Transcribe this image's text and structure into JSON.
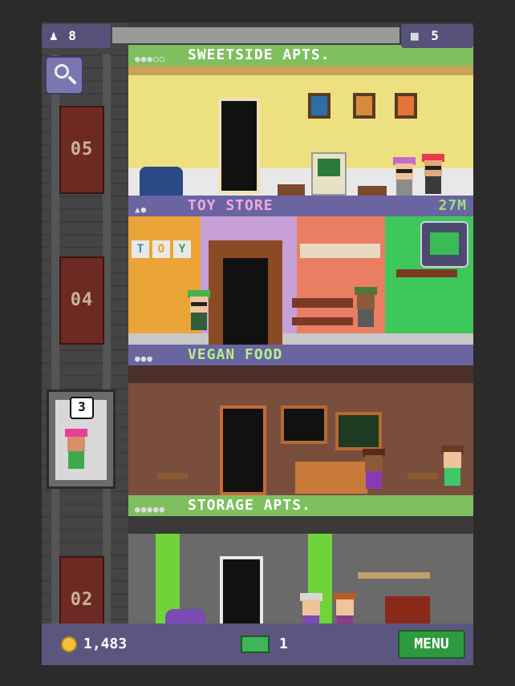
{
  "hud": {
    "residents_count": "8",
    "floors_count": "5",
    "coins": "1,483",
    "bux": "1",
    "menu_label": "MENU"
  },
  "shaft": {
    "floor_labels": [
      "05",
      "04",
      "02"
    ],
    "elevator_floor": "3"
  },
  "floors": [
    {
      "name": "SWEETSIDE APTS.",
      "kind": "residential",
      "color": "#7fbf5f",
      "room_color": "#ede081"
    },
    {
      "name": "TOY STORE",
      "kind": "retail",
      "timer": "27M",
      "color": "#6a64a0",
      "room_color": "#c7a0d8"
    },
    {
      "name": "VEGAN FOOD",
      "kind": "food",
      "color": "#7fbf5f",
      "room_color": "#7a4e3d"
    },
    {
      "name": "STORAGE APTS.",
      "kind": "residential",
      "color": "#7fbf5f",
      "room_color": "#6a6a6a"
    }
  ],
  "toy_sign": [
    "T",
    "O",
    "Y"
  ],
  "colors": {
    "hud_purple": "#5b567f",
    "menu_green": "#2e9a3e",
    "coin_gold": "#f3c23a"
  },
  "icons": {
    "residents": "person-icon",
    "floors": "building-icon",
    "search": "magnifier-icon",
    "coin": "coin-icon",
    "bux": "bux-icon"
  }
}
